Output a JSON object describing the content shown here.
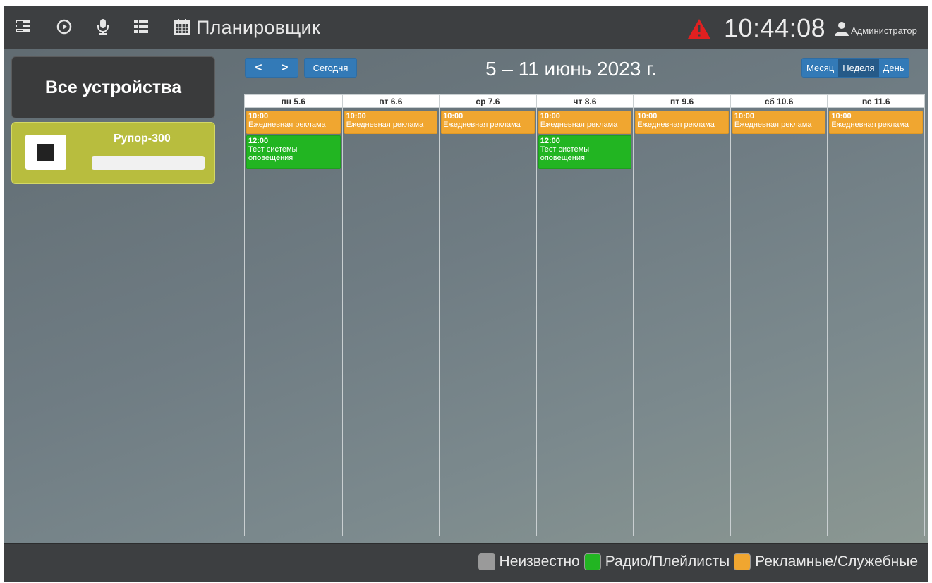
{
  "topbar": {
    "icons": [
      "server-icon",
      "play-circle-icon",
      "microphone-icon",
      "list-icon",
      "calendar-icon"
    ],
    "title": "Планировщик",
    "clock": "10:44:08",
    "user": "Администратор",
    "alert_color": "#e02020"
  },
  "sidebar": {
    "all_devices_label": "Все устройства",
    "device": {
      "name": "Рупор-300",
      "color": "#b8bd3e"
    }
  },
  "toolbar": {
    "prev_label": "<",
    "next_label": ">",
    "today_label": "Сегодня",
    "range_title": "5 – 11 июнь 2023 г.",
    "views": [
      "Месяц",
      "Неделя",
      "День"
    ],
    "active_view": "Неделя"
  },
  "calendar": {
    "days": [
      {
        "label": "пн 5.6",
        "events": [
          {
            "type": "ad",
            "time": "10:00",
            "title": "Ежедневная реклама"
          },
          {
            "type": "radio",
            "time": "12:00",
            "title": "Тест системы оповещения"
          }
        ]
      },
      {
        "label": "вт 6.6",
        "events": [
          {
            "type": "ad",
            "time": "10:00",
            "title": "Ежедневная реклама"
          }
        ]
      },
      {
        "label": "ср 7.6",
        "events": [
          {
            "type": "ad",
            "time": "10:00",
            "title": "Ежедневная реклама"
          }
        ]
      },
      {
        "label": "чт 8.6",
        "events": [
          {
            "type": "ad",
            "time": "10:00",
            "title": "Ежедневная реклама"
          },
          {
            "type": "radio",
            "time": "12:00",
            "title": "Тест системы оповещения"
          }
        ]
      },
      {
        "label": "пт 9.6",
        "events": [
          {
            "type": "ad",
            "time": "10:00",
            "title": "Ежедневная реклама"
          }
        ]
      },
      {
        "label": "сб 10.6",
        "events": [
          {
            "type": "ad",
            "time": "10:00",
            "title": "Ежедневная реклама"
          }
        ]
      },
      {
        "label": "вс 11.6",
        "events": [
          {
            "type": "ad",
            "time": "10:00",
            "title": "Ежедневная реклама"
          }
        ]
      }
    ]
  },
  "legend": [
    {
      "label": "Неизвестно",
      "color": "#9a9a9a"
    },
    {
      "label": "Радио/Плейлисты",
      "color": "#22b522"
    },
    {
      "label": "Рекламные/Служебные",
      "color": "#f0a630"
    }
  ]
}
